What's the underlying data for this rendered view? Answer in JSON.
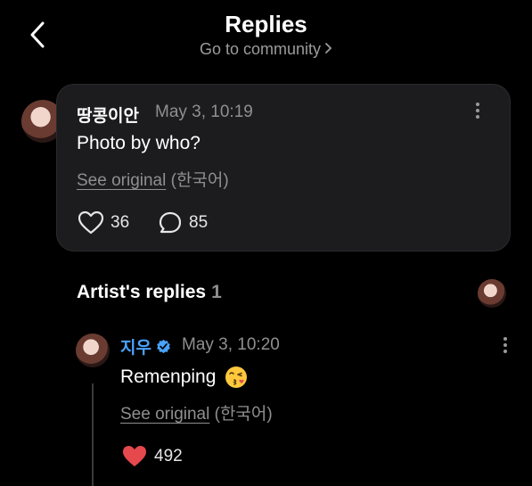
{
  "header": {
    "title": "Replies",
    "subtitle": "Go to community",
    "back_icon": "chevron-left-icon",
    "subtitle_icon": "chevron-right-icon"
  },
  "post": {
    "author": "땅콩이안",
    "time": "May 3, 10:19",
    "body": "Photo by who?",
    "see_original": "See original",
    "language": "(한국어)",
    "likes": "36",
    "comments": "85"
  },
  "artist_replies": {
    "label": "Artist's replies",
    "count": "1"
  },
  "reply": {
    "author": "지우",
    "time": "May 3, 10:20",
    "body": "Remenping",
    "emoji_icon": "kissing-face-icon",
    "see_original": "See original",
    "language": "(한국어)",
    "likes": "492"
  },
  "colors": {
    "accent_blue": "#4aa3ff",
    "like_red": "#e5484d",
    "card_bg": "#1c1c1e"
  }
}
